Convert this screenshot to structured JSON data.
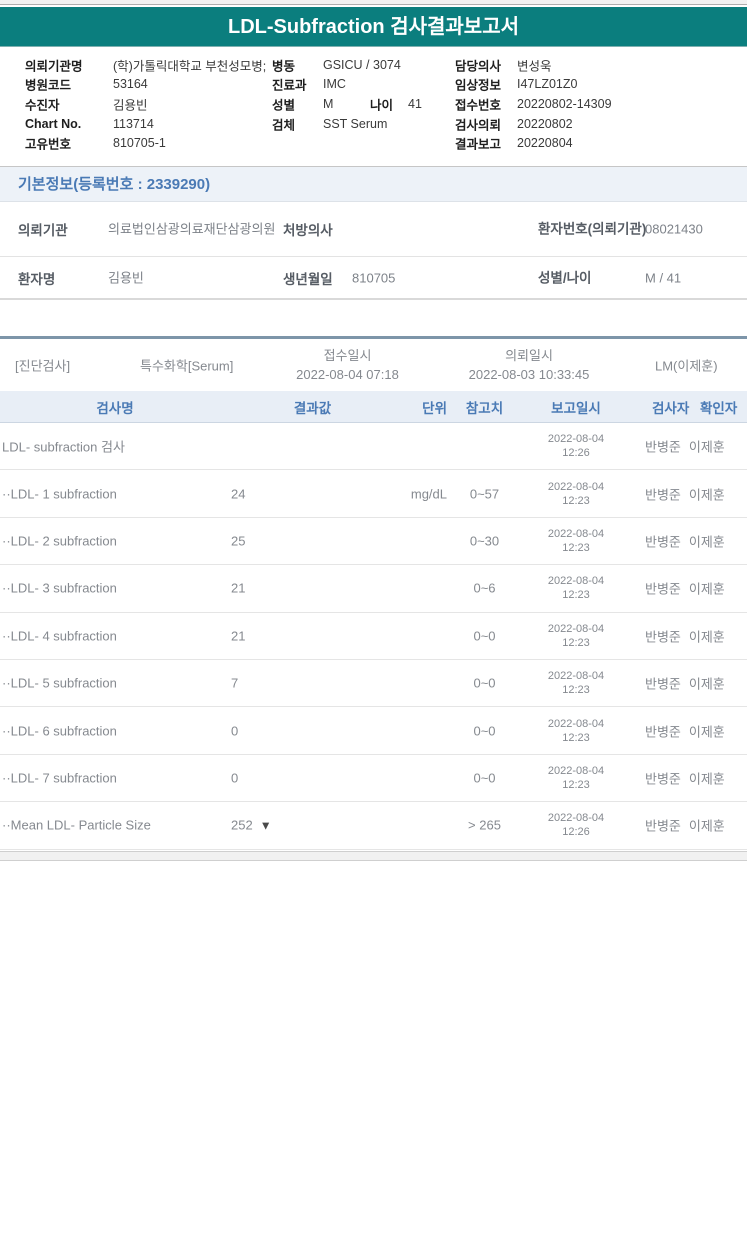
{
  "title_bar": {
    "title": "LDL-Subfraction 검사결과보고서"
  },
  "order_info": {
    "rows": [
      {
        "l1": "의뢰기관명",
        "v1": "(학)가톨릭대학교 부천성모병;",
        "l2": "병동",
        "v2": "GSICU / 3074",
        "l3": "담당의사",
        "v3": "변성욱"
      },
      {
        "l1": "병원코드",
        "v1": "53164",
        "l2": "진료과",
        "v2": "IMC",
        "l3": "임상정보",
        "v3": "I47LZ01Z0"
      },
      {
        "l1": "수진자",
        "v1": "김용빈",
        "l2": "성별",
        "v2": "M",
        "l2b": "나이",
        "v2b": "41",
        "l3": "접수번호",
        "v3": "20220802-14309"
      },
      {
        "l1": "Chart No.",
        "v1": "113714",
        "l2": "검체",
        "v2": "SST Serum",
        "l3": "검사의뢰",
        "v3": "20220802"
      },
      {
        "l1": "고유번호",
        "v1": "810705-1",
        "l3": "결과보고",
        "v3": "20220804"
      }
    ]
  },
  "basic_info": {
    "header": "기본정보(등록번호 : 2339290)",
    "r1c1_label": "의뢰기관",
    "r1c1_value": "의료법인삼광의료재단삼광의원",
    "r1c2_label": "처방의사",
    "r1c2_value": "",
    "r1c3_label": "환자번호(의뢰기관)",
    "r1c3_value": "08021430",
    "r2c1_label": "환자명",
    "r2c1_value": "김용빈",
    "r2c2_label": "생년월일",
    "r2c2_value": "810705",
    "r2c3_label": "성별/나이",
    "r2c3_value": "M / 41"
  },
  "diagnostic": {
    "section": "[진단검사]",
    "category": "특수화학[Serum]",
    "received_label": "접수일시",
    "received_value": "2022-08-04 07:18",
    "requested_label": "의뢰일시",
    "requested_value": "2022-08-03 10:33:45",
    "reporter": "LM(이제훈)"
  },
  "results": {
    "headers": {
      "name": "검사명",
      "value": "결과값",
      "unit": "단위",
      "ref": "참고치",
      "date": "보고일시",
      "tester": "검사자",
      "verifier": "확인자"
    },
    "rows": [
      {
        "name": "LDL- subfraction 검사",
        "value": "",
        "unit": "",
        "ref": "",
        "date1": "2022-08-04",
        "date2": "12:26",
        "tester": "반병준",
        "verifier": "이제훈"
      },
      {
        "name": "··LDL- 1 subfraction",
        "value": "24",
        "unit": "mg/dL",
        "ref": "0~57",
        "date1": "2022-08-04",
        "date2": "12:23",
        "tester": "반병준",
        "verifier": "이제훈"
      },
      {
        "name": "··LDL- 2 subfraction",
        "value": "25",
        "unit": "",
        "ref": "0~30",
        "date1": "2022-08-04",
        "date2": "12:23",
        "tester": "반병준",
        "verifier": "이제훈"
      },
      {
        "name": "··LDL- 3 subfraction",
        "value": "21",
        "unit": "",
        "ref": "0~6",
        "date1": "2022-08-04",
        "date2": "12:23",
        "tester": "반병준",
        "verifier": "이제훈"
      },
      {
        "name": "··LDL- 4 subfraction",
        "value": "21",
        "unit": "",
        "ref": "0~0",
        "date1": "2022-08-04",
        "date2": "12:23",
        "tester": "반병준",
        "verifier": "이제훈"
      },
      {
        "name": "··LDL- 5 subfraction",
        "value": "7",
        "unit": "",
        "ref": "0~0",
        "date1": "2022-08-04",
        "date2": "12:23",
        "tester": "반병준",
        "verifier": "이제훈"
      },
      {
        "name": "··LDL- 6 subfraction",
        "value": "0",
        "unit": "",
        "ref": "0~0",
        "date1": "2022-08-04",
        "date2": "12:23",
        "tester": "반병준",
        "verifier": "이제훈"
      },
      {
        "name": "··LDL- 7 subfraction",
        "value": "0",
        "unit": "",
        "ref": "0~0",
        "date1": "2022-08-04",
        "date2": "12:23",
        "tester": "반병준",
        "verifier": "이제훈"
      },
      {
        "name": "··Mean LDL- Particle Size",
        "value": "252",
        "flag": "▼",
        "unit": "",
        "ref": "> 265",
        "date1": "2022-08-04",
        "date2": "12:26",
        "tester": "반병준",
        "verifier": "이제훈"
      }
    ]
  },
  "icons": {
    "low_flag": "down-triangle"
  },
  "colors": {
    "teal_header": "#0b7e7e",
    "accent_blue": "#4a7ab5",
    "table_header_bg": "#e8eef6",
    "section_bg": "#edf2f8",
    "divider_blue_gray": "#7d95a9",
    "flag_down": "#4a4a4a"
  }
}
